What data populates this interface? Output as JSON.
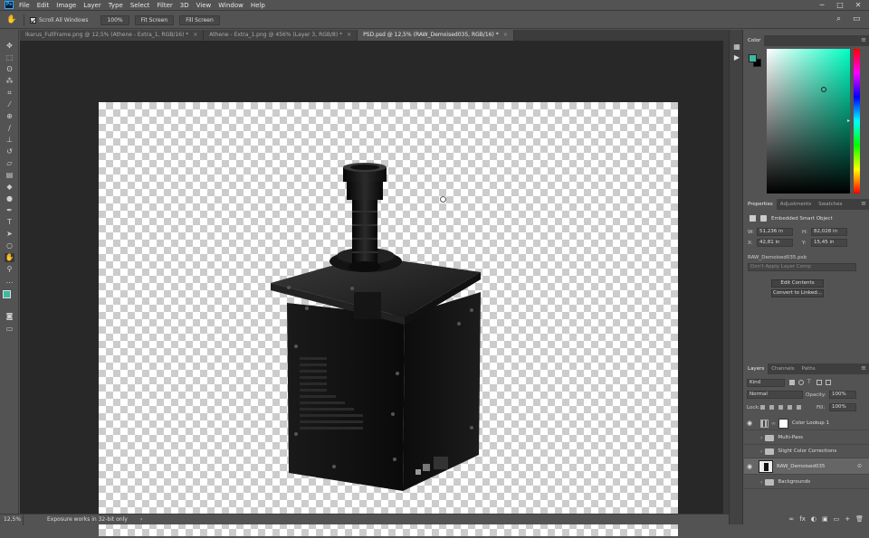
{
  "app": {
    "logo": "Ps"
  },
  "menu": [
    "File",
    "Edit",
    "Image",
    "Layer",
    "Type",
    "Select",
    "Filter",
    "3D",
    "View",
    "Window",
    "Help"
  ],
  "window_controls": {
    "minimize": "─",
    "maximize": "□",
    "close": "✕"
  },
  "options_bar": {
    "tool_icon": "hand-icon",
    "tool_icon_glyph": "✋",
    "scroll_all_windows": "Scroll All Windows",
    "btn_100": "100%",
    "btn_fit": "Fit Screen",
    "btn_fill": "Fill Screen",
    "search_glyph": "⌕",
    "workspace_glyph": "▭"
  },
  "tabs": [
    {
      "label": "Ikarus_FullFrame.png @ 12,5% (Athene - Extra_1, RGB/16) *",
      "active": false
    },
    {
      "label": "Athene - Extra_1.png @ 456% (Layer 3, RGB/8) *",
      "active": false
    },
    {
      "label": "PSD.psd @ 12,5% (RAW_Demoised035, RGB/16) *",
      "active": true
    }
  ],
  "tab_close": "×",
  "tools": [
    {
      "name": "move-tool-icon",
      "glyph": "✥"
    },
    {
      "name": "marquee-tool-icon",
      "glyph": "⬚"
    },
    {
      "name": "lasso-tool-icon",
      "glyph": "ʘ"
    },
    {
      "name": "magic-wand-tool-icon",
      "glyph": "⁂"
    },
    {
      "name": "crop-tool-icon",
      "glyph": "⌗"
    },
    {
      "name": "eyedropper-tool-icon",
      "glyph": "⁄"
    },
    {
      "name": "healing-brush-tool-icon",
      "glyph": "⊕"
    },
    {
      "name": "brush-tool-icon",
      "glyph": "∕"
    },
    {
      "name": "clone-stamp-tool-icon",
      "glyph": "⊥"
    },
    {
      "name": "history-brush-tool-icon",
      "glyph": "↺"
    },
    {
      "name": "eraser-tool-icon",
      "glyph": "▱"
    },
    {
      "name": "gradient-tool-icon",
      "glyph": "▤"
    },
    {
      "name": "blur-tool-icon",
      "glyph": "◆"
    },
    {
      "name": "dodge-tool-icon",
      "glyph": "●"
    },
    {
      "name": "pen-tool-icon",
      "glyph": "✒"
    },
    {
      "name": "type-tool-icon",
      "glyph": "T"
    },
    {
      "name": "path-selection-tool-icon",
      "glyph": "➤"
    },
    {
      "name": "shape-tool-icon",
      "glyph": "○"
    },
    {
      "name": "hand-tool-icon",
      "glyph": "✋",
      "active": true
    },
    {
      "name": "zoom-tool-icon",
      "glyph": "⚲"
    },
    {
      "name": "more-tools-icon",
      "glyph": "…"
    }
  ],
  "colors": {
    "foreground": "#3cb9a0",
    "background": "#000000",
    "accent": "#31a8ff"
  },
  "status": {
    "zoom": "12,5%",
    "message": "Exposure works in 32-bit only",
    "arrow": "›"
  },
  "dock": {
    "color_icon": "▦",
    "play_icon": "▶"
  },
  "color_panel": {
    "tab": "Color",
    "menu": "≡"
  },
  "properties_panel": {
    "tabs": [
      "Properties",
      "Adjustments",
      "Swatches"
    ],
    "type_label": "Embedded Smart Object",
    "w_label": "W:",
    "w_value": "51,236 in",
    "h_label": "H:",
    "h_value": "82,028 in",
    "x_label": "X:",
    "x_value": "42,81 in",
    "y_label": "Y:",
    "y_value": "15,45 in",
    "filename": "RAW_Demoised035.psb",
    "layer_comp": "Don't Apply Layer Comp",
    "edit_contents": "Edit Contents",
    "convert": "Convert to Linked..."
  },
  "layers_panel": {
    "tabs": [
      "Layers",
      "Channels",
      "Paths"
    ],
    "filter_kind": "Kind",
    "blend_mode": "Normal",
    "opacity_label": "Opacity:",
    "opacity": "100%",
    "lock_label": "Lock:",
    "fill_label": "Fill:",
    "fill": "100%",
    "layers": [
      {
        "name": "Color Lookup 1",
        "type": "adjustment",
        "visible": true
      },
      {
        "name": "Multi-Pass",
        "type": "group",
        "visible": false
      },
      {
        "name": "Slight Color Corrections",
        "type": "group",
        "visible": false
      },
      {
        "name": "RAW_Demoised035",
        "type": "smart",
        "visible": true,
        "selected": true
      },
      {
        "name": "Backgrounds",
        "type": "group",
        "visible": false
      }
    ],
    "bottom_icons": [
      "fx",
      "◐",
      "▣",
      "▭",
      "+",
      "🗑"
    ]
  }
}
